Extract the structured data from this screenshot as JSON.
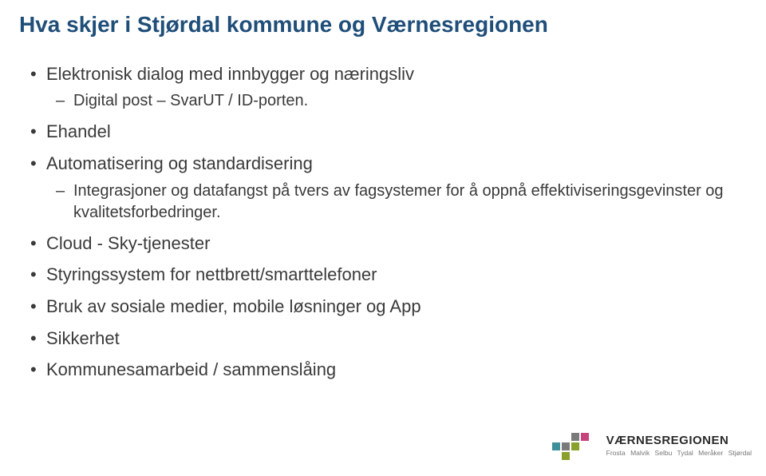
{
  "title": "Hva skjer i Stjørdal kommune og Værnesregionen",
  "bullets": [
    {
      "text": "Elektronisk dialog med innbygger og næringsliv",
      "sub": [
        "Digital post – SvarUT / ID-porten."
      ]
    },
    {
      "text": "Ehandel"
    },
    {
      "text": "Automatisering og standardisering",
      "sub": [
        "Integrasjoner og datafangst på tvers av fagsystemer for å oppnå effektiviseringsgevinster og kvalitetsforbedringer."
      ]
    },
    {
      "text": "Cloud - Sky-tjenester"
    },
    {
      "text": "Styringssystem for nettbrett/smarttelefoner"
    },
    {
      "text": "Bruk av sosiale medier, mobile løsninger og App"
    },
    {
      "text": "Sikkerhet"
    },
    {
      "text": "Kommunesamarbeid / sammenslåing"
    }
  ],
  "logo": {
    "name": "VÆRNESREGIONEN",
    "subtitle": "Frosta  Malvik  Selbu  Tydal  Meråker  Stjørdal",
    "colors": {
      "green": "#8aa02c",
      "pink": "#c7427b",
      "teal": "#3d8f9b",
      "gray": "#7a7a7a"
    }
  }
}
